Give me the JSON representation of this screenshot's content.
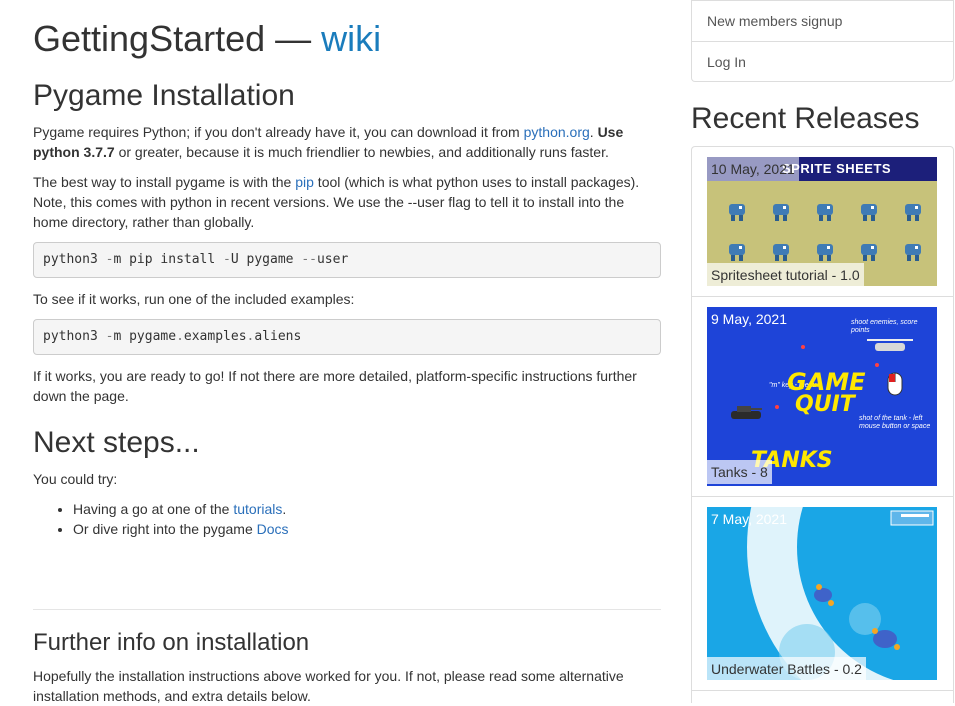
{
  "page": {
    "title_prefix": "GettingStarted — ",
    "title_link": "wiki"
  },
  "install": {
    "heading": "Pygame Installation",
    "p1_a": "Pygame requires Python; if you don't already have it, you can download it from ",
    "p1_link": "python.org",
    "p1_b": ". ",
    "p1_bold": "Use python 3.7.7",
    "p1_c": " or greater, because it is much friendlier to newbies, and additionally runs faster.",
    "p2_a": "The best way to install pygame is with the ",
    "p2_link": "pip",
    "p2_b": " tool (which is what python uses to install packages). Note, this comes with python in recent versions. We use the --user flag to tell it to install into the home directory, rather than globally.",
    "code1": {
      "t1": "python3 ",
      "t2": "-",
      "t3": "m pip install ",
      "t4": "-",
      "t5": "U pygame ",
      "t6": "--",
      "t7": "user"
    },
    "p3": "To see if it works, run one of the included examples:",
    "code2": {
      "t1": "python3 ",
      "t2": "-",
      "t3": "m pygame",
      "t4": ".",
      "t5": "examples",
      "t6": ".",
      "t7": "aliens"
    },
    "p4": "If it works, you are ready to go! If not there are more detailed, platform-specific instructions further down the page."
  },
  "next": {
    "heading": "Next steps...",
    "intro": "You could try:",
    "item1_a": "Having a go at one of the ",
    "item1_link": "tutorials",
    "item1_b": ".",
    "item2_a": "Or dive right into the pygame ",
    "item2_link": "Docs"
  },
  "further": {
    "heading": "Further info on installation",
    "p": "Hopefully the installation instructions above worked for you. If not, please read some alternative installation methods, and extra details below."
  },
  "sidebar": {
    "menu": [
      "New members signup",
      "Log In"
    ],
    "releases_heading": "Recent Releases",
    "releases": [
      {
        "date": "10 May, 2021",
        "name": "Spritesheet tutorial - 1.0",
        "image_text": "SPRITE SHEETS"
      },
      {
        "date": "9 May, 2021",
        "name": "Tanks - 8",
        "image_text_1": "GAME",
        "image_text_2": "QUIT",
        "image_text_3": "TANKS",
        "image_small_1": "shoot enemies, score points",
        "image_small_2": "\"m\" key - menu",
        "image_small_3": "shot of the tank - left mouse button or space"
      },
      {
        "date": "7 May, 2021",
        "name": "Underwater Battles - 0.2"
      }
    ]
  },
  "colors": {
    "link": "#2a6fba",
    "title_link": "#1a7cbc",
    "code_bg": "#f5f5f5",
    "border": "#dddddd"
  }
}
